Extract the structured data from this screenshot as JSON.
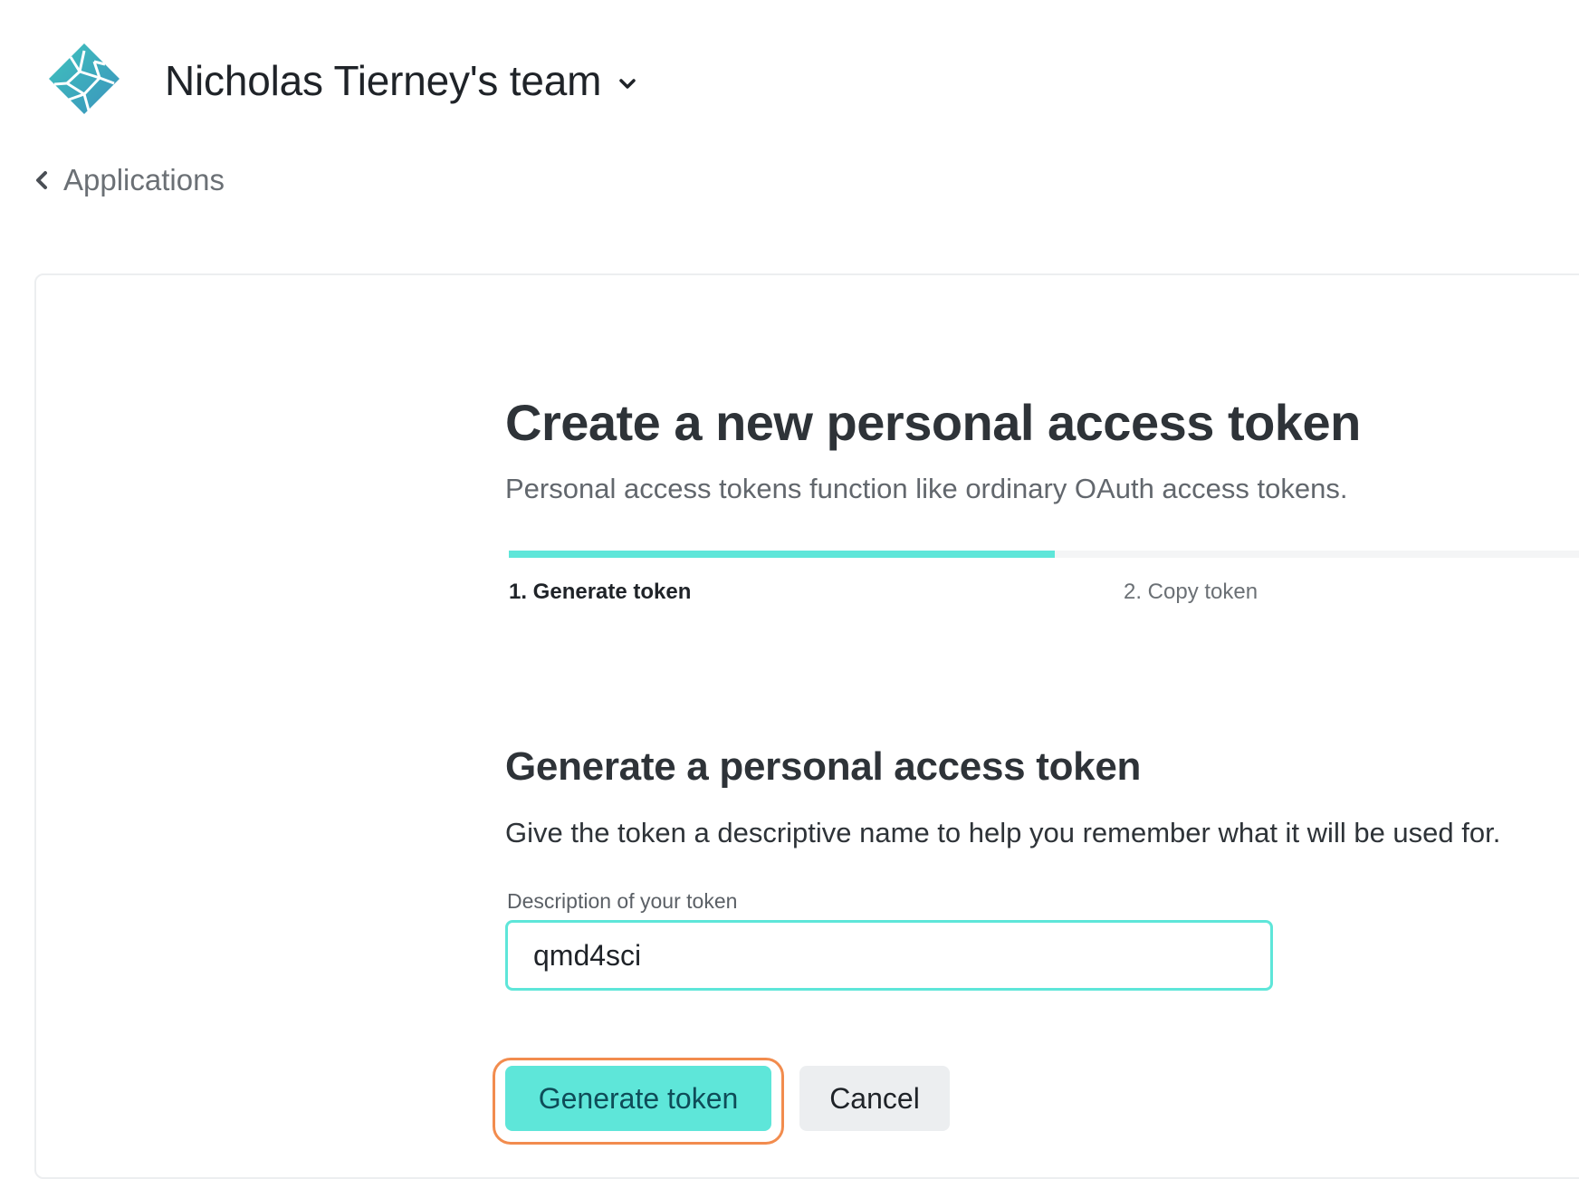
{
  "header": {
    "team_name": "Nicholas Tierney's team",
    "logo_icon": "netlify-logo-icon",
    "dropdown_icon": "chevron-down-icon"
  },
  "breadcrumb": {
    "back_label": "Applications",
    "back_icon": "chevron-left-icon"
  },
  "page": {
    "title": "Create a new personal access token",
    "subtitle": "Personal access tokens function like ordinary OAuth access tokens."
  },
  "stepper": {
    "progress": 0.51,
    "steps": [
      {
        "label": "1. Generate token",
        "active": true
      },
      {
        "label": "2. Copy token",
        "active": false
      }
    ]
  },
  "form": {
    "section_title": "Generate a personal access token",
    "section_description": "Give the token a descriptive name to help you remember what it will be used for.",
    "field_label": "Description of your token",
    "field_value": "qmd4sci",
    "primary_button": "Generate token",
    "secondary_button": "Cancel"
  },
  "colors": {
    "accent": "#5ee6d9",
    "highlight_outline": "#f28c4e",
    "button_text": "#0e4c58",
    "logo_teal": "#3ab8b8"
  }
}
